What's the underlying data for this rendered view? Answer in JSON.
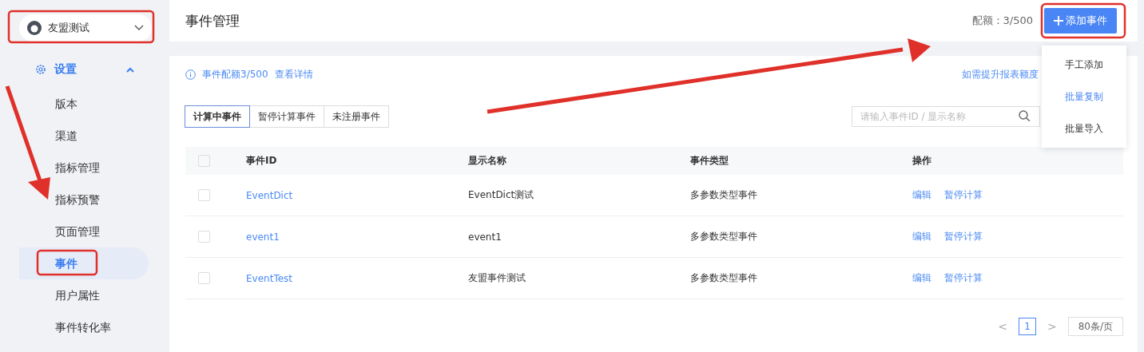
{
  "app_select": {
    "value": "友盟测试"
  },
  "sidebar": {
    "group": {
      "label": "设置",
      "expanded": true
    },
    "items": [
      {
        "label": "版本",
        "selected": false
      },
      {
        "label": "渠道",
        "selected": false
      },
      {
        "label": "指标管理",
        "selected": false
      },
      {
        "label": "指标预警",
        "selected": false
      },
      {
        "label": "页面管理",
        "selected": false
      },
      {
        "label": "事件",
        "selected": true
      },
      {
        "label": "用户属性",
        "selected": false
      },
      {
        "label": "事件转化率",
        "selected": false
      }
    ]
  },
  "header": {
    "title": "事件管理",
    "quota": "配额：3/500",
    "add_button": "添加事件"
  },
  "add_menu": [
    {
      "label": "手工添加",
      "selected": false
    },
    {
      "label": "批量复制",
      "selected": true
    },
    {
      "label": "批量导入",
      "selected": false
    }
  ],
  "notice": {
    "text": "事件配额3/500",
    "link": "查看详情",
    "right_link": "如需提升报表额度"
  },
  "tabs": [
    {
      "label": "计算中事件",
      "selected": true
    },
    {
      "label": "暂停计算事件",
      "selected": false
    },
    {
      "label": "未注册事件",
      "selected": false
    }
  ],
  "search": {
    "placeholder": "请输入事件ID / 显示名称"
  },
  "table": {
    "select_all": {
      "checked": false
    },
    "columns": [
      "事件ID",
      "显示名称",
      "事件类型",
      "操作"
    ],
    "rows": [
      {
        "checked": false,
        "id": "EventDict",
        "name": "EventDict测试",
        "type": "多参数类型事件",
        "actions": [
          "编辑",
          "暂停计算"
        ]
      },
      {
        "checked": false,
        "id": "event1",
        "name": "event1",
        "type": "多参数类型事件",
        "actions": [
          "编辑",
          "暂停计算"
        ]
      },
      {
        "checked": false,
        "id": "EventTest",
        "name": "友盟事件测试",
        "type": "多参数类型事件",
        "actions": [
          "编辑",
          "暂停计算"
        ]
      }
    ]
  },
  "pagination": {
    "prev": "<",
    "pages": [
      {
        "label": "1",
        "selected": true
      }
    ],
    "next": ">",
    "page_size": "80条/页"
  }
}
